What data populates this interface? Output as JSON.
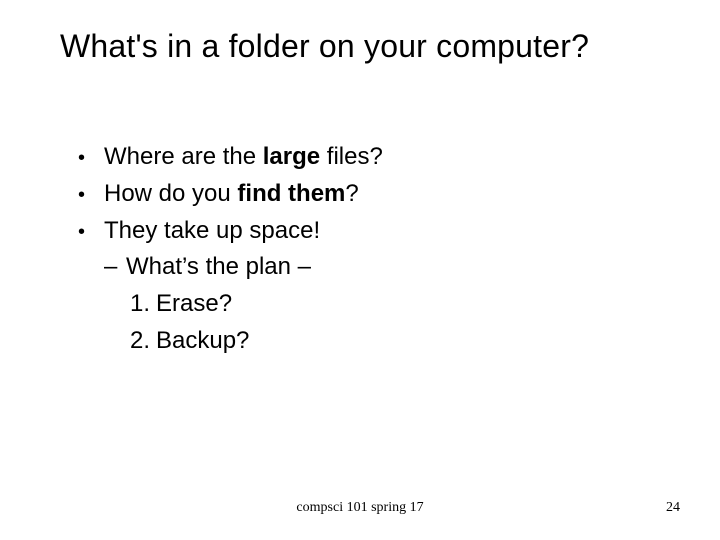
{
  "title": "What's in a folder on your computer?",
  "bullets": {
    "b1_pre": "Where are the ",
    "b1_bold": "large",
    "b1_post": " files?",
    "b2_pre": "How do you ",
    "b2_bold": "find them",
    "b2_post": "?",
    "b3": "They take up space!"
  },
  "dash": {
    "mark": "–",
    "text_pre": "What’s the plan ",
    "text_post": "–"
  },
  "nums": {
    "n1_mark": "1.",
    "n1_text": "Erase?",
    "n2_mark": "2.",
    "n2_text": "Backup?"
  },
  "footer": {
    "center": "compsci 101 spring 17",
    "page": "24"
  },
  "glyphs": {
    "bullet": "•"
  }
}
